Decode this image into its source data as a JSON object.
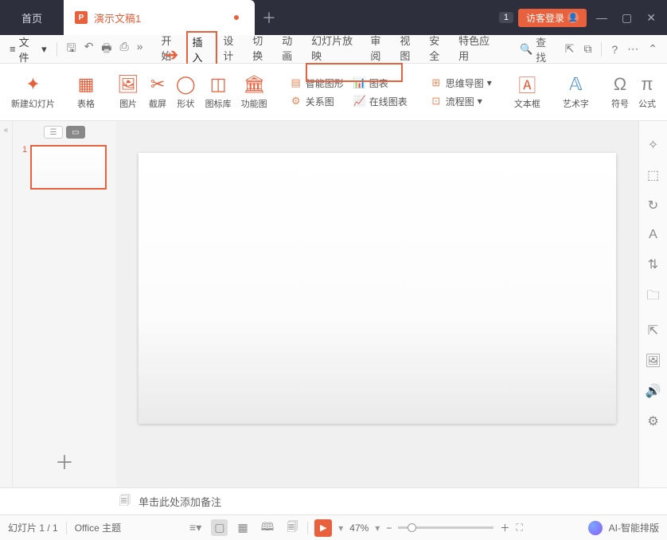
{
  "titlebar": {
    "home_tab": "首页",
    "doc_icon": "P",
    "doc_title": "演示文稿1",
    "badge": "1",
    "login": "访客登录"
  },
  "menubar": {
    "file": "文件",
    "tabs": [
      "开始",
      "插入",
      "设计",
      "切换",
      "动画",
      "幻灯片放映",
      "审阅",
      "视图",
      "安全",
      "特色应用"
    ],
    "search_label": "查找"
  },
  "ribbon": {
    "new_slide": "新建幻灯片",
    "table": "表格",
    "image": "图片",
    "screenshot": "截屏",
    "shape": "形状",
    "icon_lib": "图标库",
    "func_chart": "功能图",
    "smart_art": "智能图形",
    "relation": "关系图",
    "chart": "图表",
    "online_chart": "在线图表",
    "mindmap": "思维导图",
    "flowchart": "流程图",
    "textbox": "文本框",
    "wordart": "艺术字",
    "symbol": "符号",
    "formula": "公式"
  },
  "thumbs": {
    "num1": "1"
  },
  "notes": {
    "placeholder": "单击此处添加备注"
  },
  "statusbar": {
    "slide_count": "幻灯片 1 / 1",
    "theme": "Office 主题",
    "zoom": "47%",
    "ai": "AI-智能排版"
  }
}
